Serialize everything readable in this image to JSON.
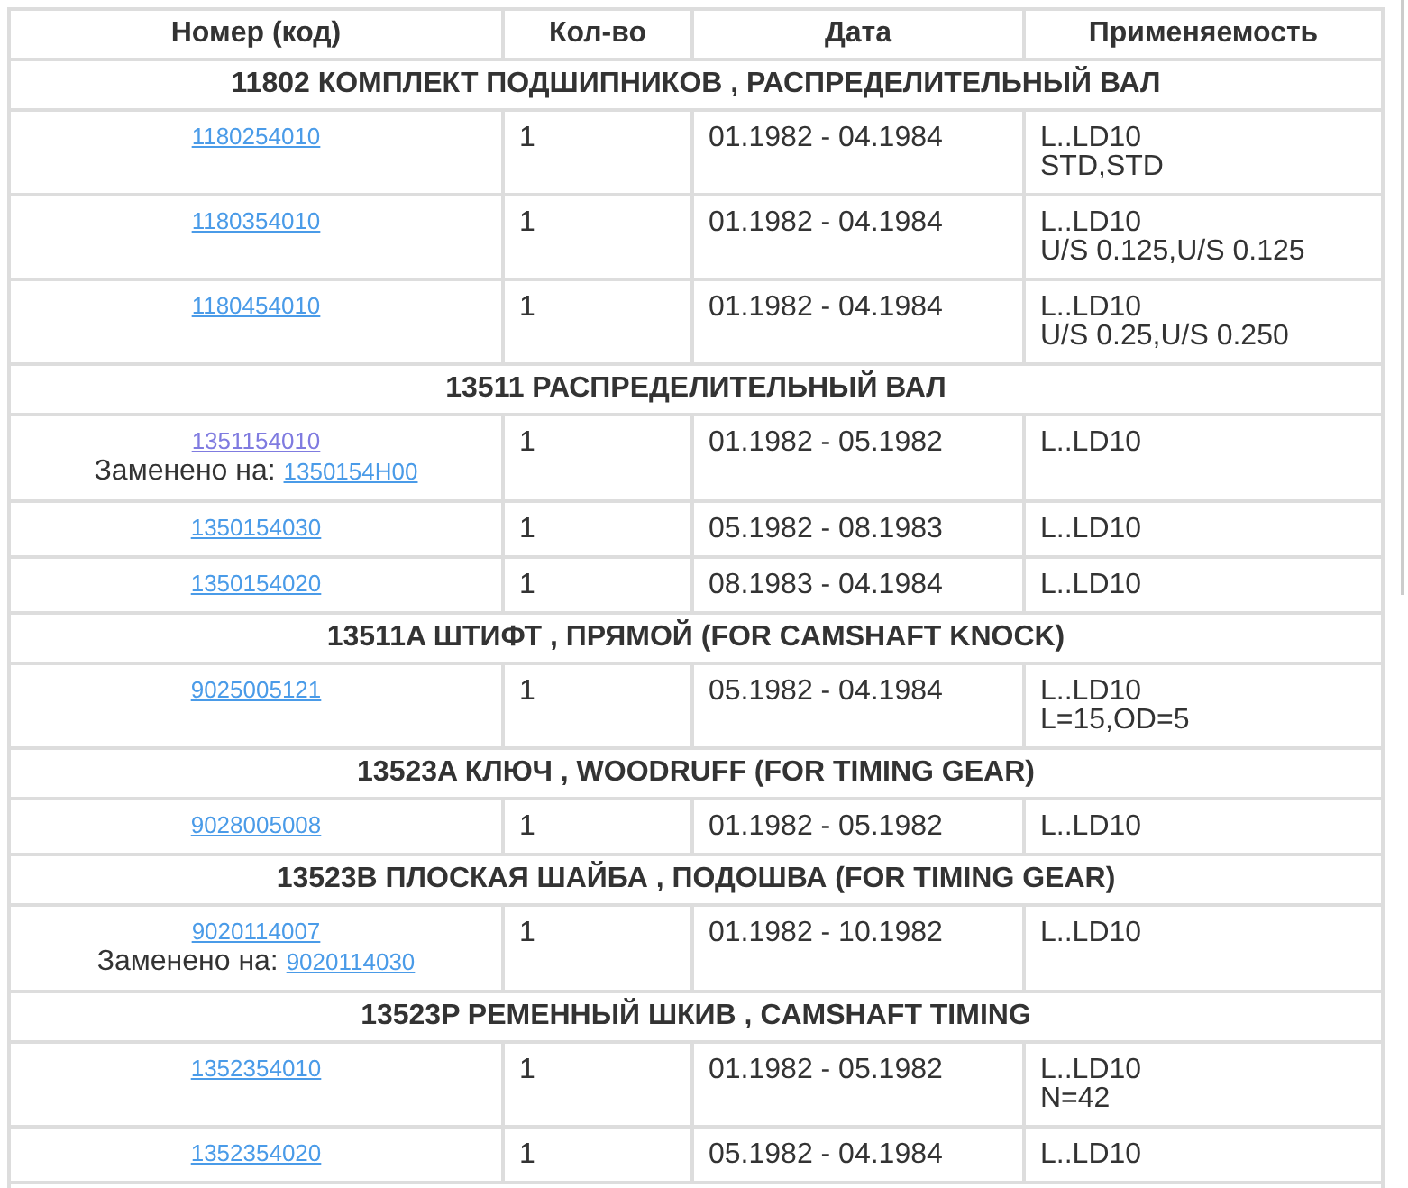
{
  "table": {
    "columns": [
      "Номер (код)",
      "Кол-во",
      "Дата",
      "Применяемость"
    ],
    "groups": [
      {
        "title": "11802 КОМПЛЕКТ ПОДШИПНИКОВ , РАСПРЕДЕЛИТЕЛЬНЫЙ ВАЛ",
        "parts": [
          {
            "code": "1180254010",
            "visited": false,
            "qty": "1",
            "date": "01.1982 - 04.1984",
            "applicability": [
              "L..LD10",
              "STD,STD"
            ]
          },
          {
            "code": "1180354010",
            "visited": false,
            "qty": "1",
            "date": "01.1982 - 04.1984",
            "applicability": [
              "L..LD10",
              "U/S 0.125,U/S 0.125"
            ]
          },
          {
            "code": "1180454010",
            "visited": false,
            "qty": "1",
            "date": "01.1982 - 04.1984",
            "applicability": [
              "L..LD10",
              "U/S 0.25,U/S 0.250"
            ]
          }
        ]
      },
      {
        "title": "13511 РАСПРЕДЕЛИТЕЛЬНЫЙ ВАЛ",
        "parts": [
          {
            "code": "1351154010",
            "visited": true,
            "replaced_label": "Заменено на:",
            "replaced_by": "1350154H00",
            "qty": "1",
            "date": "01.1982 - 05.1982",
            "applicability": [
              "L..LD10"
            ]
          },
          {
            "code": "1350154030",
            "visited": false,
            "qty": "1",
            "date": "05.1982 - 08.1983",
            "applicability": [
              "L..LD10"
            ]
          },
          {
            "code": "1350154020",
            "visited": false,
            "qty": "1",
            "date": "08.1983 - 04.1984",
            "applicability": [
              "L..LD10"
            ]
          }
        ]
      },
      {
        "title": "13511A ШТИФТ , ПРЯМОЙ (FOR CAMSHAFT KNOCK)",
        "parts": [
          {
            "code": "9025005121",
            "visited": false,
            "qty": "1",
            "date": "05.1982 - 04.1984",
            "applicability": [
              "L..LD10",
              "L=15,OD=5"
            ]
          }
        ]
      },
      {
        "title": "13523A КЛЮЧ , WOODRUFF (FOR TIMING GEAR)",
        "parts": [
          {
            "code": "9028005008",
            "visited": false,
            "qty": "1",
            "date": "01.1982 - 05.1982",
            "applicability": [
              "L..LD10"
            ]
          }
        ]
      },
      {
        "title": "13523B ПЛОСКАЯ ШАЙБА , ПОДОШВА (FOR TIMING GEAR)",
        "parts": [
          {
            "code": "9020114007",
            "visited": false,
            "replaced_label": "Заменено на:",
            "replaced_by": "9020114030",
            "qty": "1",
            "date": "01.1982 - 10.1982",
            "applicability": [
              "L..LD10"
            ]
          }
        ]
      },
      {
        "title": "13523P РЕМЕННЫЙ ШКИВ , CAMSHAFT TIMING",
        "parts": [
          {
            "code": "1352354010",
            "visited": false,
            "qty": "1",
            "date": "01.1982 - 05.1982",
            "applicability": [
              "L..LD10",
              "N=42"
            ]
          },
          {
            "code": "1352354020",
            "visited": false,
            "qty": "1",
            "date": "05.1982 - 04.1984",
            "applicability": [
              "L..LD10"
            ]
          }
        ]
      }
    ]
  }
}
